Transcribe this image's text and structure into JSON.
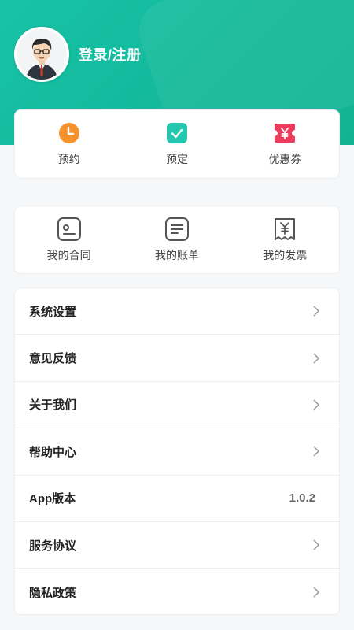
{
  "header": {
    "login_label": "登录/注册",
    "accent_color": "#14b89b"
  },
  "quick_actions": [
    {
      "label": "预约",
      "icon": "clock-icon",
      "color": "#f5922b"
    },
    {
      "label": "预定",
      "icon": "check-icon",
      "color": "#22c7ad"
    },
    {
      "label": "优惠券",
      "icon": "coupon-icon",
      "color": "#ee3d5c"
    }
  ],
  "my_section": [
    {
      "label": "我的合同",
      "icon": "contract-icon"
    },
    {
      "label": "我的账单",
      "icon": "bill-icon"
    },
    {
      "label": "我的发票",
      "icon": "invoice-icon"
    }
  ],
  "menu": [
    {
      "label": "系统设置"
    },
    {
      "label": "意见反馈"
    },
    {
      "label": "关于我们"
    },
    {
      "label": "帮助中心"
    },
    {
      "label": "App版本",
      "value": "1.0.2"
    },
    {
      "label": "服务协议"
    },
    {
      "label": "隐私政策"
    }
  ]
}
